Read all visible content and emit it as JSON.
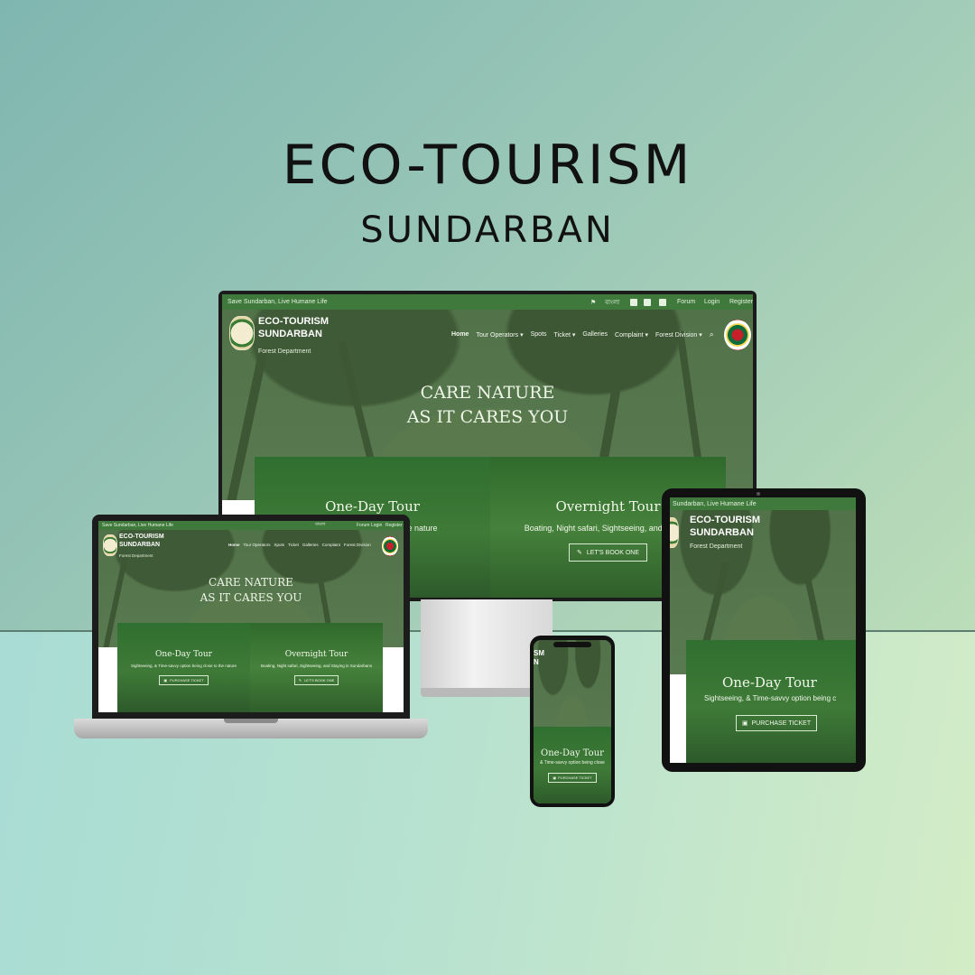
{
  "headline": {
    "title": "ECO-TOURISM",
    "subtitle": "SUNDARBAN"
  },
  "site": {
    "tagline": "Save Sundarban, Live Humane Life",
    "tagline_short": "Sundarban, Live Humane Life",
    "lang": "বাংলা",
    "top_links": [
      "Forum",
      "Login",
      "Register"
    ],
    "brand_line1": "ECO-TOURISM",
    "brand_line2": "SUNDARBAN",
    "brand_sub": "Forest Department",
    "nav": [
      "Home",
      "Tour Operators",
      "Spots",
      "Ticket",
      "Galleries",
      "Complaint",
      "Forest Division"
    ],
    "hero_line1": "CARE NATURE",
    "hero_line2": "AS IT CARES YOU",
    "card1_title": "One-Day Tour",
    "card1_title_tablet": "One-Day Tour",
    "card1_desc_monitor": "close to the nature",
    "card1_desc_laptop": "Sightseeing, & Time-savvy option being close to the nature",
    "card1_desc_tablet": "Sightseeing, & Time-savvy option being c",
    "card1_desc_phone": "& Time-savvy option being close",
    "card1_btn": "PURCHASE TICKET",
    "card2_title": "Overnight Tour",
    "card2_desc_monitor": "Boating, Night safari, Sightseeing, and Staying",
    "card2_desc_laptop": "Boating, Night safari, Sightseeing, and Staying in Sundarbans",
    "card2_btn": "LET'S BOOK ONE",
    "phone_brand1": "SM",
    "phone_brand2": "N"
  },
  "colors": {
    "topbar": "#3f7a3c",
    "forest": "#4b6a42",
    "card": "#2e6a2c"
  }
}
